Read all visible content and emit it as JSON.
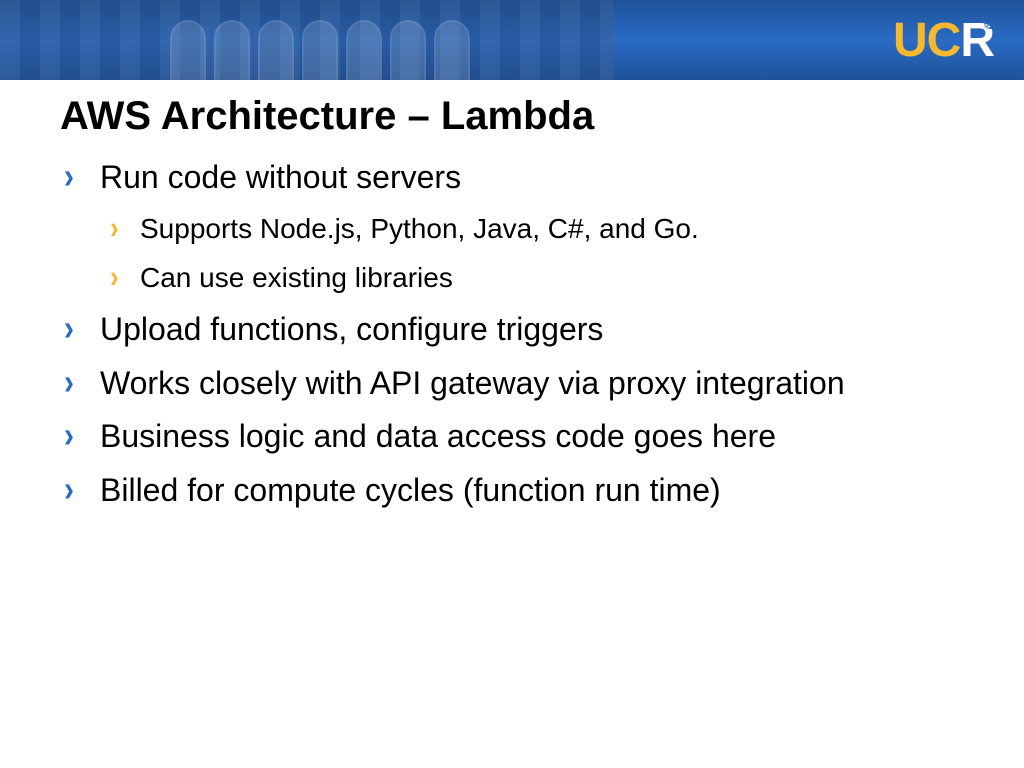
{
  "logo": {
    "uc": "UC",
    "r": "R"
  },
  "title": "AWS Architecture – Lambda",
  "bullets": [
    {
      "text": "Run code without servers",
      "sub": [
        "Supports Node.js, Python, Java, C#, and Go.",
        "Can use existing libraries"
      ]
    },
    {
      "text": "Upload functions, configure triggers"
    },
    {
      "text": "Works closely with API gateway via proxy integration"
    },
    {
      "text": "Business logic and data access code goes here"
    },
    {
      "text": "Billed for compute cycles (function run time)"
    }
  ]
}
